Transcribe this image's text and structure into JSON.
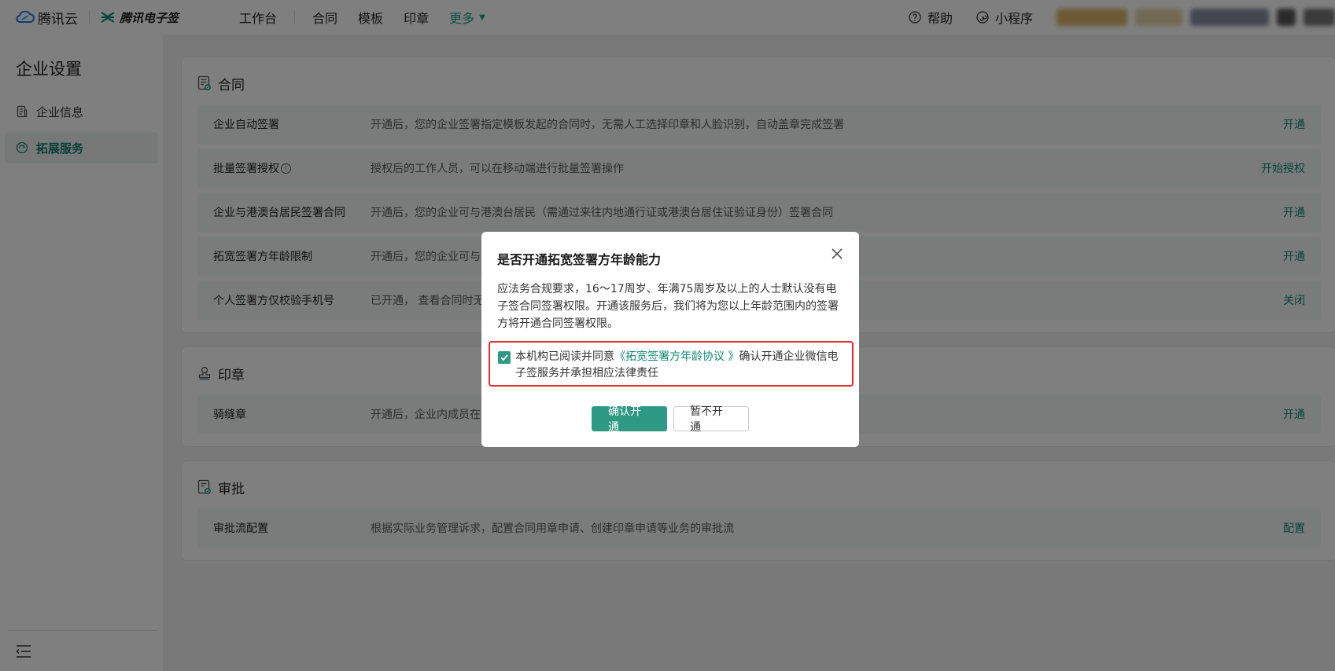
{
  "header": {
    "brand_cloud": "腾讯云",
    "brand_esign": "腾讯电子签",
    "nav": [
      {
        "label": "工作台"
      },
      {
        "label": "合同"
      },
      {
        "label": "模板"
      },
      {
        "label": "印章"
      },
      {
        "label": "更多"
      }
    ],
    "help": "帮助",
    "miniprogram": "小程序"
  },
  "sidebar": {
    "title": "企业设置",
    "items": [
      {
        "label": "企业信息",
        "icon": "document-icon",
        "active": false
      },
      {
        "label": "拓展服务",
        "icon": "extend-service-icon",
        "active": true
      }
    ]
  },
  "sections": [
    {
      "title": "合同",
      "icon": "contract-icon",
      "rows": [
        {
          "name": "企业自动签署",
          "desc": "开通后，您的企业签署指定模板发起的合同时，无需人工选择印章和人脸识别，自动盖章完成签署",
          "action": "开通"
        },
        {
          "name": "批量签署授权",
          "desc": "授权后的工作人员，可以在移动端进行批量签署操作",
          "action": "开始授权"
        },
        {
          "name": "企业与港澳台居民签署合同",
          "desc": "开通后，您的企业可与港澳台居民（需通过来往内地通行证或港澳台居住证验证身份）签署合同",
          "action": "开通"
        },
        {
          "name": "拓宽签署方年龄限制",
          "desc": "开通后，您的企业可与",
          "action": "开通"
        },
        {
          "name": "个人签署方仅校验手机号",
          "desc": "已开通， 查看合同时无",
          "action": "关闭"
        }
      ]
    },
    {
      "title": "印章",
      "icon": "seal-icon",
      "rows": [
        {
          "name": "骑缝章",
          "desc": "开通后，企业内成员在",
          "action": "开通"
        }
      ]
    },
    {
      "title": "审批",
      "icon": "approval-icon",
      "rows": [
        {
          "name": "审批流配置",
          "desc": "根据实际业务管理诉求，配置合同用章申请、创建印章申请等业务的审批流",
          "action": "配置"
        }
      ]
    }
  ],
  "dialog": {
    "title": "是否开通拓宽签署方年龄能力",
    "body": "应法务合规要求，16～17周岁、年满75周岁及以上的人士默认没有电子签合同签署权限。开通该服务后，我们将为您以上年龄范围内的签署方将开通合同签署权限。",
    "agree_prefix": "本机构已阅读并同意",
    "agree_link": "《拓宽签署方年龄协议 》",
    "agree_suffix": "确认开通企业微信电子签服务并承担相应法律责任",
    "checked": true,
    "confirm": "确认开通",
    "cancel": "暂不开通"
  },
  "colors": {
    "accent": "#0f8a72",
    "primary_button": "#2e9a83",
    "highlight_border": "#e0302f"
  }
}
